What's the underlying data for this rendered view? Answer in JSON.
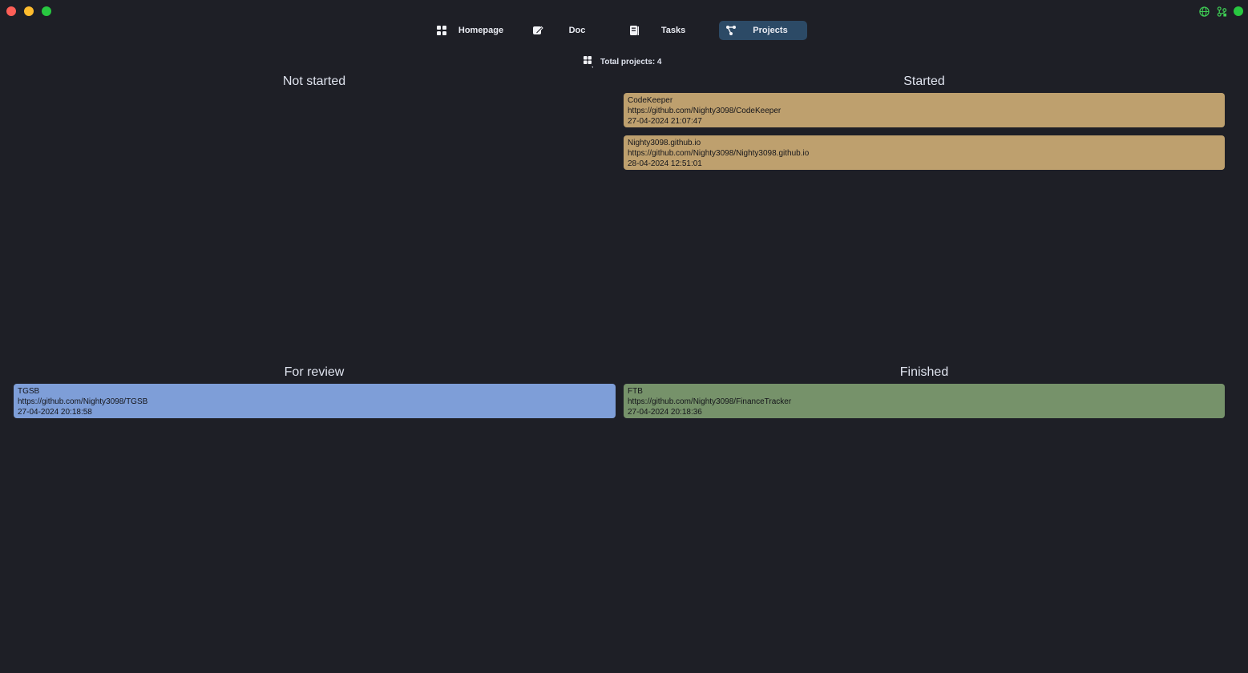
{
  "window": {
    "controls": [
      "close",
      "minimize",
      "zoom"
    ]
  },
  "status_icons": [
    "globe-icon",
    "branch-icon",
    "status-dot"
  ],
  "nav": {
    "items": [
      {
        "label": "Homepage",
        "icon": "grid-icon"
      },
      {
        "label": "Doc",
        "icon": "edit-icon"
      },
      {
        "label": "Tasks",
        "icon": "checklist-icon"
      },
      {
        "label": "Projects",
        "icon": "graph-icon",
        "active": true
      }
    ]
  },
  "summary": {
    "label": "Total projects: 4"
  },
  "columns": {
    "not_started": {
      "title": "Not started",
      "cards": []
    },
    "started": {
      "title": "Started",
      "color": "#bea06e",
      "cards": [
        {
          "name": "CodeKeeper",
          "url": "https://github.com/Nighty3098/CodeKeeper",
          "date": "27-04-2024 21:07:47"
        },
        {
          "name": "Nighty3098.github.io",
          "url": "https://github.com/Nighty3098/Nighty3098.github.io",
          "date": "28-04-2024 12:51:01"
        }
      ]
    },
    "for_review": {
      "title": "For review",
      "color": "#7e9ed8",
      "cards": [
        {
          "name": "TGSB",
          "url": "https://github.com/Nighty3098/TGSB",
          "date": "27-04-2024 20:18:58"
        }
      ]
    },
    "finished": {
      "title": "Finished",
      "color": "#76926a",
      "cards": [
        {
          "name": "FTB",
          "url": "https://github.com/Nighty3098/FinanceTracker",
          "date": "27-04-2024 20:18:36"
        }
      ]
    }
  }
}
